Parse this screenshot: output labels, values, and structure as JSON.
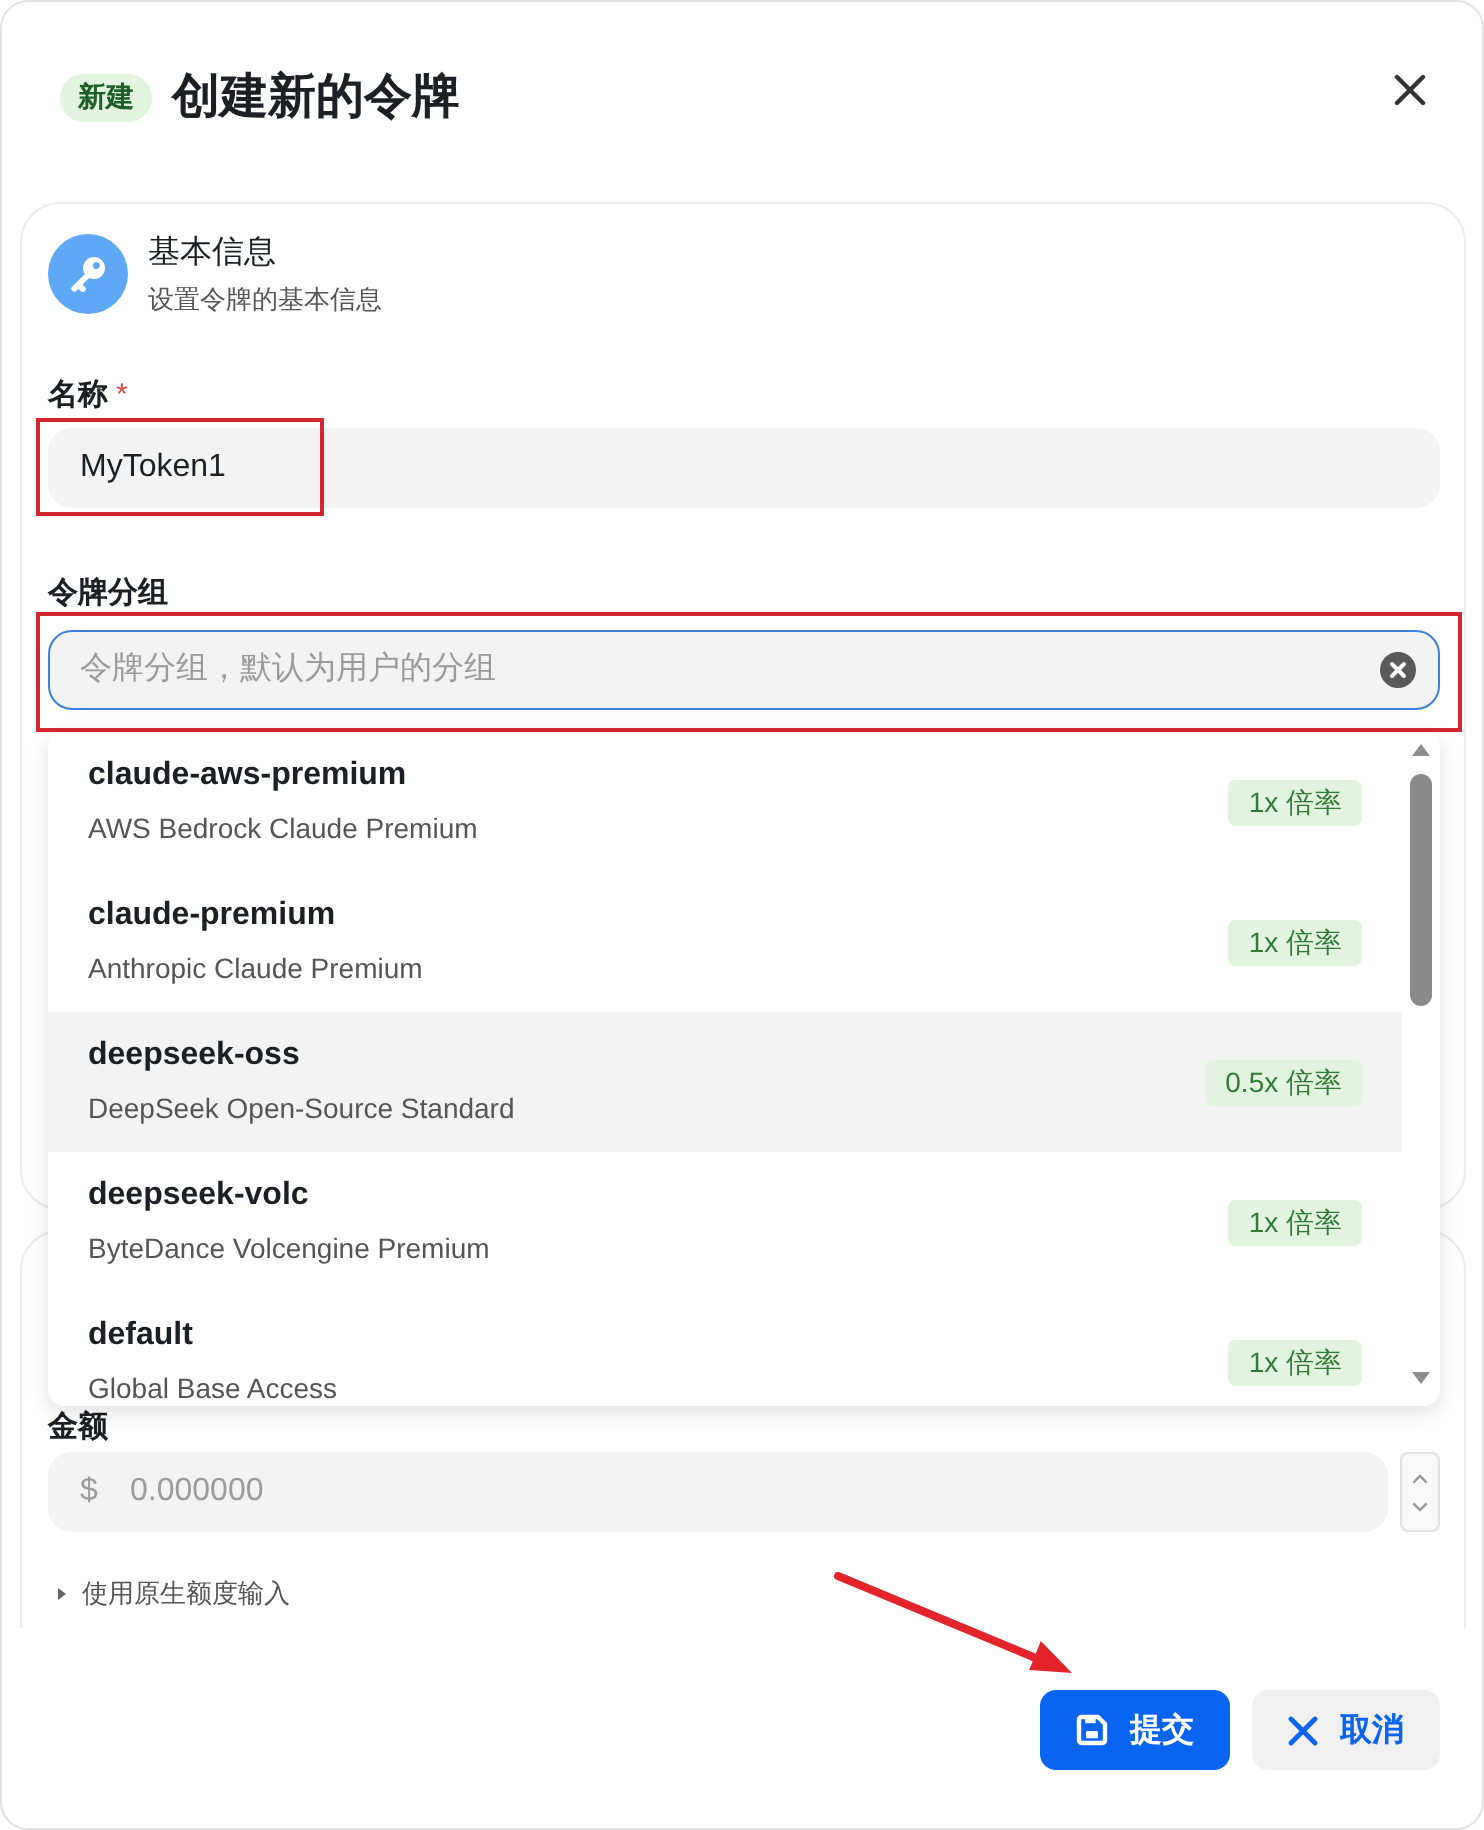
{
  "dialog": {
    "badge": "新建",
    "title": "创建新的令牌"
  },
  "basic_section": {
    "title": "基本信息",
    "subtitle": "设置令牌的基本信息"
  },
  "name_field": {
    "label": "名称",
    "required_mark": "*",
    "value": "MyToken1",
    "highlighted": true
  },
  "group_field": {
    "label": "令牌分组",
    "placeholder": "令牌分组，默认为用户的分组",
    "focused": true,
    "highlighted": true,
    "expanded": true,
    "options": [
      {
        "name": "claude-aws-premium",
        "description": "AWS Bedrock Claude Premium",
        "ratio": "1x 倍率",
        "selected": false
      },
      {
        "name": "claude-premium",
        "description": "Anthropic Claude Premium",
        "ratio": "1x 倍率",
        "selected": false
      },
      {
        "name": "deepseek-oss",
        "description": "DeepSeek Open-Source Standard",
        "ratio": "0.5x 倍率",
        "selected": true
      },
      {
        "name": "deepseek-volc",
        "description": "ByteDance Volcengine Premium",
        "ratio": "1x 倍率",
        "selected": false
      },
      {
        "name": "default",
        "description": "Global Base Access",
        "ratio": "1x 倍率",
        "selected": false
      }
    ]
  },
  "amount_field": {
    "label": "金额",
    "currency": "$",
    "placeholder": "0.000000"
  },
  "native_quota_toggle": {
    "label": "使用原生额度输入",
    "expanded": false
  },
  "buttons": [
    {
      "kind": "submit",
      "label": "提交",
      "pointed_at": true
    },
    {
      "kind": "cancel",
      "label": "取消",
      "pointed_at": false
    }
  ]
}
